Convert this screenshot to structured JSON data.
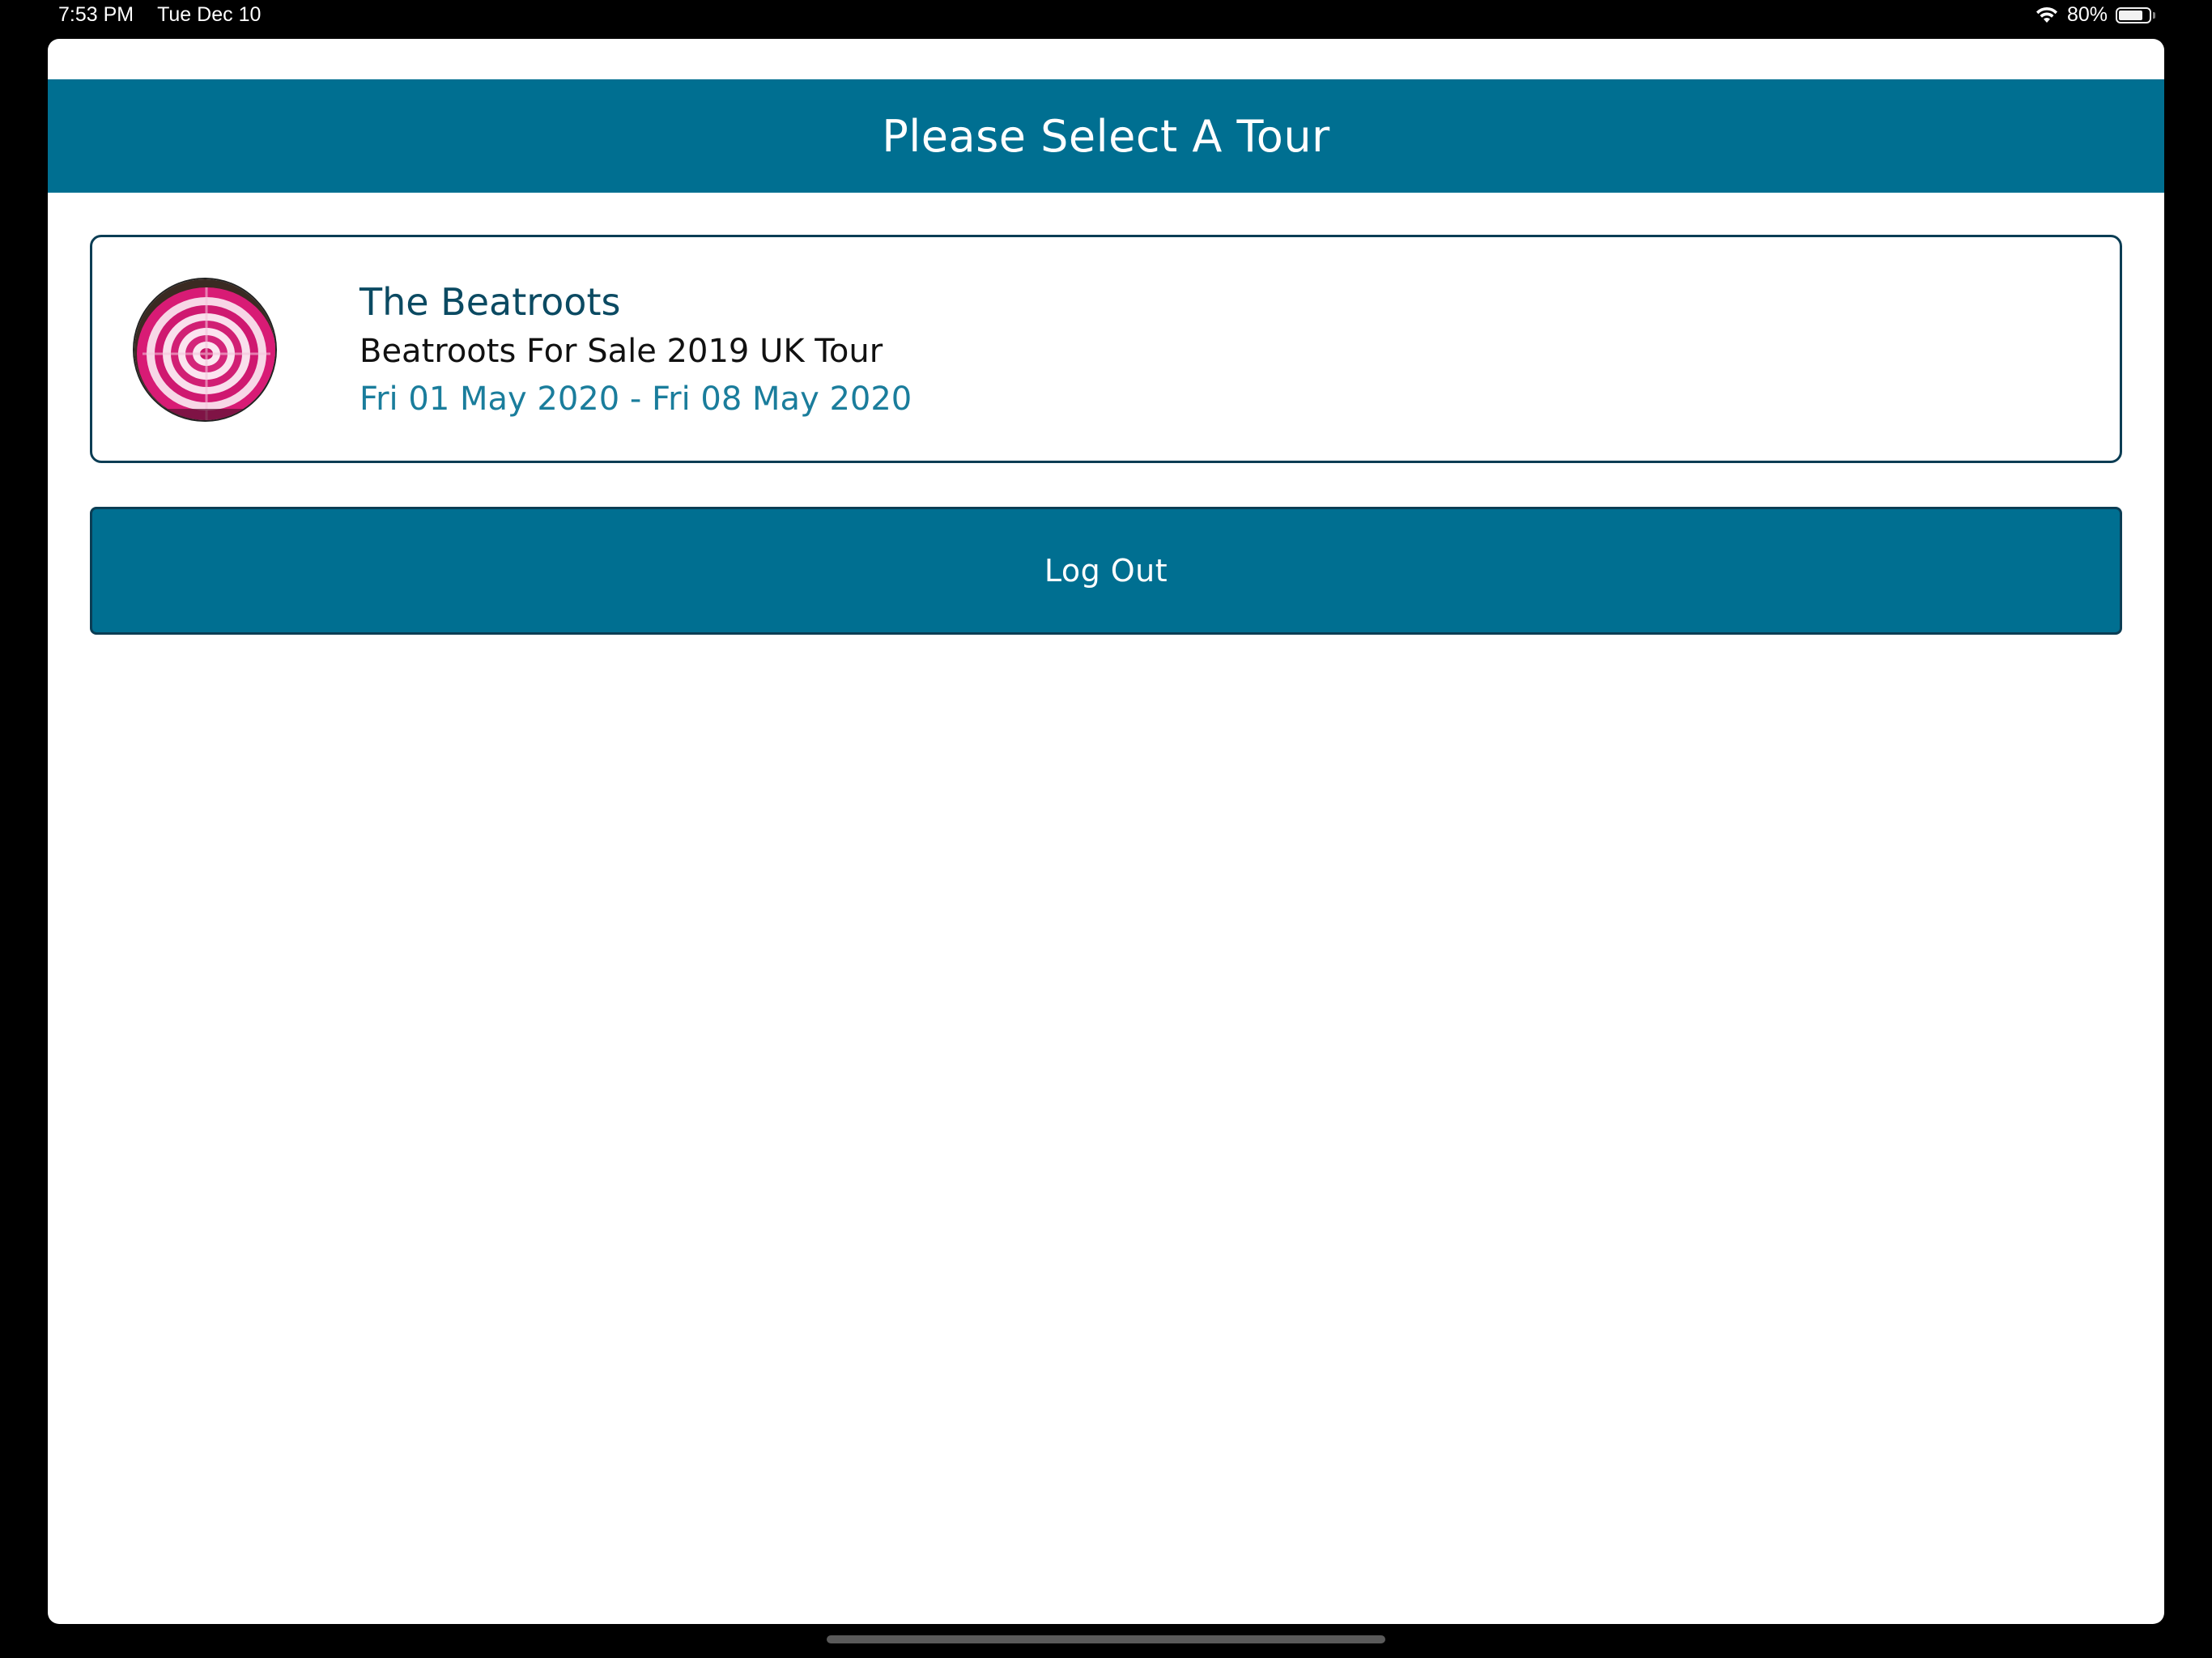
{
  "status_bar": {
    "time": "7:53 PM",
    "date": "Tue Dec 10",
    "battery_percent": "80%",
    "battery_level": 0.8,
    "icons": [
      "wifi-icon",
      "battery-icon"
    ]
  },
  "header": {
    "title": "Please Select A Tour"
  },
  "tours": [
    {
      "artist": "The Beatroots",
      "name": "Beatroots For Sale 2019 UK Tour",
      "dates": "Fri 01 May 2020 - Fri 08 May 2020"
    }
  ],
  "actions": {
    "logout_label": "Log Out"
  },
  "colors": {
    "header_bg": "#006f91",
    "card_border": "#0b3d54",
    "artist_text": "#0b4a62",
    "dates_text": "#1a7d9c",
    "button_bg": "#006f91"
  }
}
